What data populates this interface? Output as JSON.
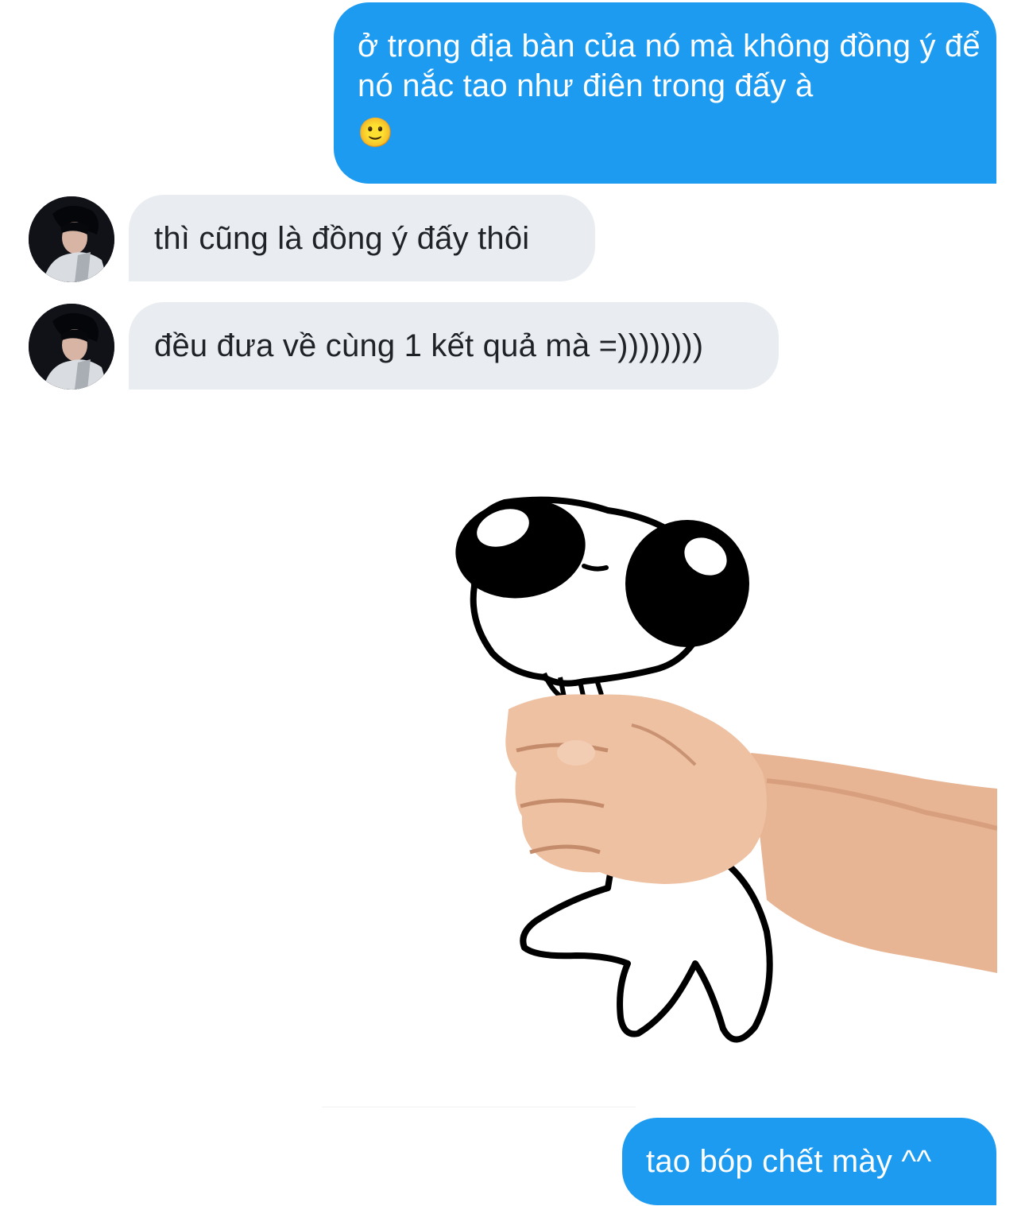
{
  "messages": [
    {
      "sender": "me",
      "text": "ở trong địa bàn của nó mà không đồng ý để nó nắc tao như điên trong đấy à",
      "emoji": "🙂"
    },
    {
      "sender": "them",
      "text": "thì cũng là đồng ý đấy thôi"
    },
    {
      "sender": "them",
      "text": "đều đưa về cùng 1 kết quả mà =))))))))"
    },
    {
      "sender": "me",
      "type": "sticker",
      "sticker": "cartoon-creature-squeezed-by-hand"
    },
    {
      "sender": "me",
      "text": "tao bóp chết mày ^^"
    }
  ],
  "colors": {
    "outgoing_bubble": "#1d9bf0",
    "incoming_bubble": "#e9edf1",
    "outgoing_text": "#ffffff",
    "incoming_text": "#1f2327"
  }
}
